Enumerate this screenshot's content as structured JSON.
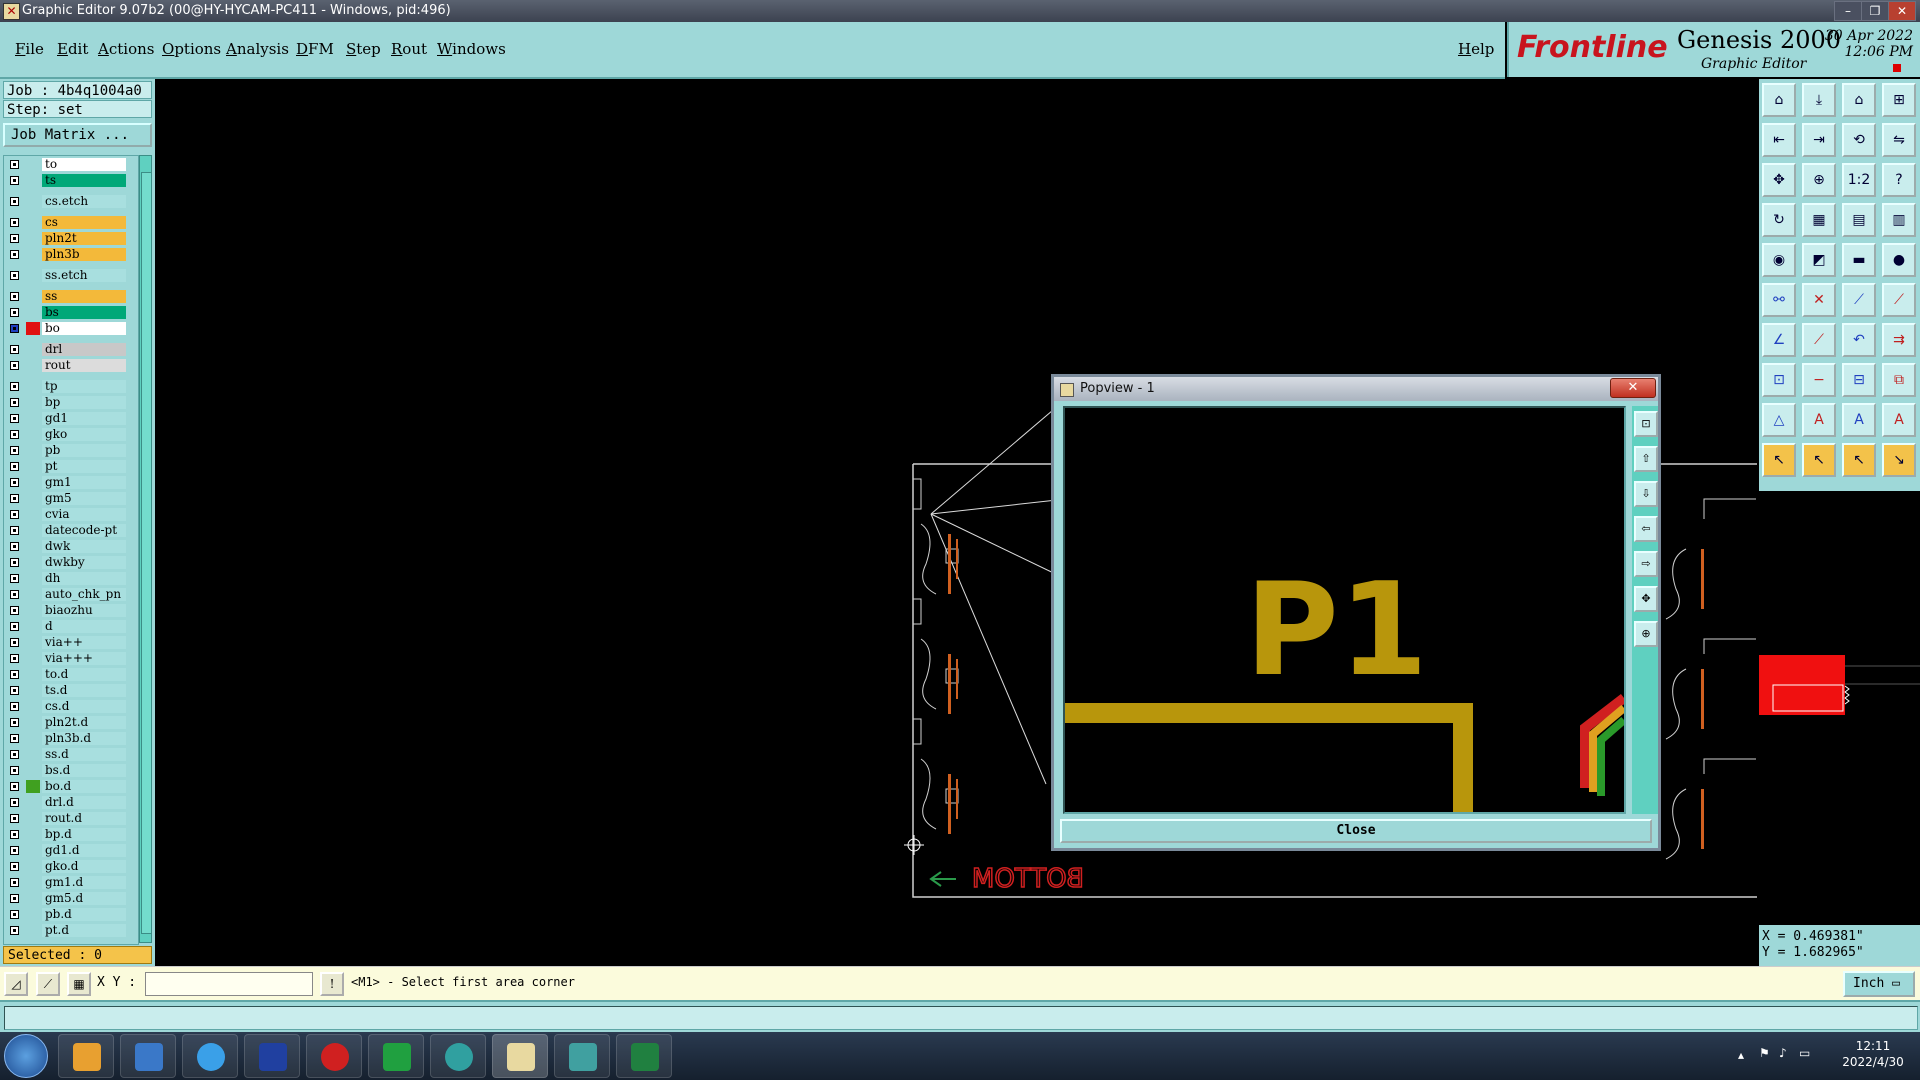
{
  "window": {
    "title": "Graphic Editor 9.07b2 (00@HY-HYCAM-PC411 - Windows, pid:496)"
  },
  "menu": [
    "File",
    "Edit",
    "Actions",
    "Options",
    "Analysis",
    "DFM",
    "Step",
    "Rout",
    "Windows"
  ],
  "help": "Help",
  "logo": {
    "brand": "Frontline",
    "product": "Genesis 2000",
    "subtitle": "Graphic Editor",
    "date": "30 Apr 2022",
    "time": "12:06 PM"
  },
  "panel": {
    "job": "Job : 4b4q1004a0",
    "step": "Step: set",
    "job_matrix": "Job Matrix ...",
    "selected": "Selected : 0"
  },
  "layers": [
    {
      "name": "to",
      "color": "#ffffff"
    },
    {
      "name": "ts",
      "color": "#00a878"
    },
    {
      "name": "cs.etch",
      "color": "#a8dfdf"
    },
    {
      "name": "cs",
      "color": "#f3b93a"
    },
    {
      "name": "pln2t",
      "color": "#f3b93a"
    },
    {
      "name": "pln3b",
      "color": "#f3b93a"
    },
    {
      "name": "ss.etch",
      "color": "#a8dfdf"
    },
    {
      "name": "ss",
      "color": "#f3b93a"
    },
    {
      "name": "bs",
      "color": "#00a878"
    },
    {
      "name": "bo",
      "color": "#ffffff"
    },
    {
      "name": "drl",
      "color": "#c8c8c8"
    },
    {
      "name": "rout",
      "color": "#dcdcdc"
    },
    {
      "name": "tp",
      "color": "#a8dfdf"
    },
    {
      "name": "bp",
      "color": "#a8dfdf"
    },
    {
      "name": "gd1",
      "color": "#a8dfdf"
    },
    {
      "name": "gko",
      "color": "#a8dfdf"
    },
    {
      "name": "pb",
      "color": "#a8dfdf"
    },
    {
      "name": "pt",
      "color": "#a8dfdf"
    },
    {
      "name": "gm1",
      "color": "#a8dfdf"
    },
    {
      "name": "gm5",
      "color": "#a8dfdf"
    },
    {
      "name": "cvia",
      "color": "#a8dfdf"
    },
    {
      "name": "datecode-pt",
      "color": "#a8dfdf"
    },
    {
      "name": "dwk",
      "color": "#a8dfdf"
    },
    {
      "name": "dwkby",
      "color": "#a8dfdf"
    },
    {
      "name": "dh",
      "color": "#a8dfdf"
    },
    {
      "name": "auto_chk_pn",
      "color": "#a8dfdf"
    },
    {
      "name": "biaozhu",
      "color": "#a8dfdf"
    },
    {
      "name": "d",
      "color": "#a8dfdf"
    },
    {
      "name": "via++",
      "color": "#a8dfdf"
    },
    {
      "name": "via+++",
      "color": "#a8dfdf"
    },
    {
      "name": "to.d",
      "color": "#a8dfdf"
    },
    {
      "name": "ts.d",
      "color": "#a8dfdf"
    },
    {
      "name": "cs.d",
      "color": "#a8dfdf"
    },
    {
      "name": "pln2t.d",
      "color": "#a8dfdf"
    },
    {
      "name": "pln3b.d",
      "color": "#a8dfdf"
    },
    {
      "name": "ss.d",
      "color": "#a8dfdf"
    },
    {
      "name": "bs.d",
      "color": "#a8dfdf"
    },
    {
      "name": "bo.d",
      "color": "#a8dfdf"
    },
    {
      "name": "drl.d",
      "color": "#a8dfdf"
    },
    {
      "name": "rout.d",
      "color": "#a8dfdf"
    },
    {
      "name": "bp.d",
      "color": "#a8dfdf"
    },
    {
      "name": "gd1.d",
      "color": "#a8dfdf"
    },
    {
      "name": "gko.d",
      "color": "#a8dfdf"
    },
    {
      "name": "gm1.d",
      "color": "#a8dfdf"
    },
    {
      "name": "gm5.d",
      "color": "#a8dfdf"
    },
    {
      "name": "pb.d",
      "color": "#a8dfdf"
    },
    {
      "name": "pt.d",
      "color": "#a8dfdf"
    }
  ],
  "canvas": {
    "board_text": "BOTTOM"
  },
  "popup": {
    "title": "Popview - 1",
    "close": "Close",
    "label": "P1"
  },
  "coords": {
    "x": "X = 0.469381\"",
    "y": "Y = 1.682965\""
  },
  "command": {
    "xy_label": "X Y :",
    "xy_value": "",
    "prompt": "<M1> - Select first area corner",
    "unit": "Inch"
  },
  "taskbar": {
    "time": "12:11",
    "date": "2022/4/30"
  },
  "toolbar_labels": {
    "scale": "1:2",
    "help": "?"
  }
}
